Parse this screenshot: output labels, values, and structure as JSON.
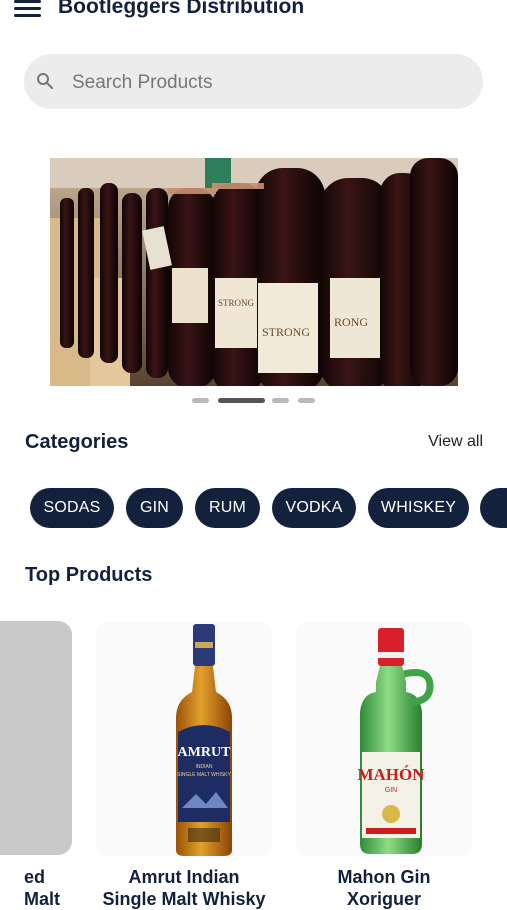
{
  "header": {
    "title": "Bootleggers Distribution",
    "menu_icon": "hamburger-menu-icon"
  },
  "search": {
    "placeholder": "Search Products",
    "value": ""
  },
  "carousel": {
    "slide_count": 4,
    "active_index": 1,
    "image": "wine-bottles-shelf"
  },
  "categories": {
    "title": "Categories",
    "view_all_label": "View all",
    "items": [
      "SODAS",
      "GIN",
      "RUM",
      "VODKA",
      "WHISKEY"
    ]
  },
  "top_products": {
    "title": "Top Products",
    "items": [
      {
        "name_line1": "ed",
        "name_line2": "Malt"
      },
      {
        "name_line1": "Amrut Indian",
        "name_line2": "Single Malt Whisky",
        "image": "amrut-bottle"
      },
      {
        "name_line1": "Mahon Gin",
        "name_line2": "Xoriguer",
        "image": "mahon-gin-bottle"
      }
    ]
  },
  "colors": {
    "primary": "#14213d",
    "chip_text": "#ffffff",
    "search_bg": "#ececec"
  }
}
